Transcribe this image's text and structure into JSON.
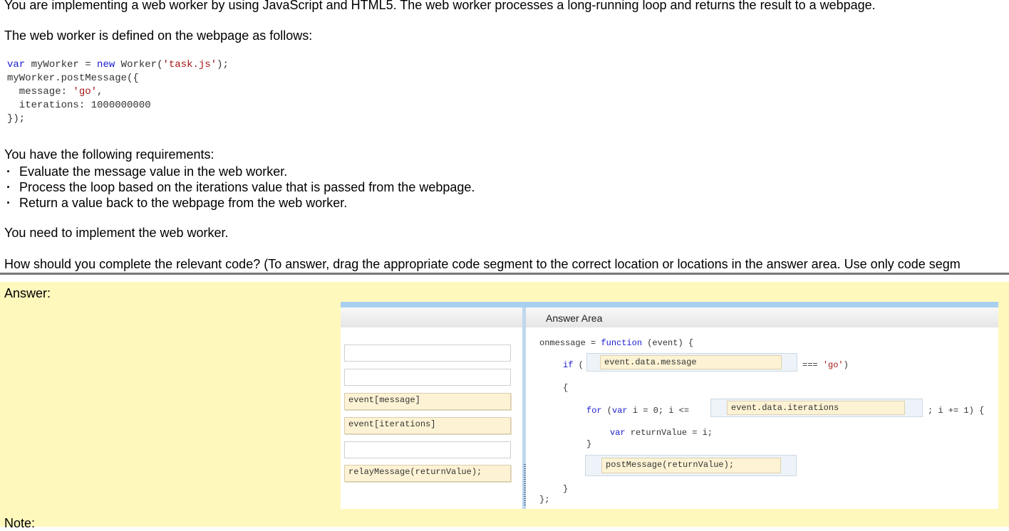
{
  "question": {
    "intro": "You are implementing a web worker by using JavaScript and HTML5. The web worker processes a long-running loop and returns the result to a webpage.",
    "defined_as": "The web worker is defined on the webpage as follows:",
    "code": {
      "line1_kw_var": "var",
      "line1_a": " myWorker = ",
      "line1_kw_new": "new",
      "line1_b": " Worker(",
      "line1_str": "'task.js'",
      "line1_c": ");",
      "line2": "myWorker.postMessage({",
      "line3_a": "  message: ",
      "line3_str": "'go'",
      "line3_b": ",",
      "line4": "  iterations: 1000000000",
      "line5": "});"
    },
    "requirements_heading": "You have the following requirements:",
    "requirements": [
      "Evaluate the message value in the web worker.",
      "Process the loop based on the iterations value that is passed from the webpage.",
      "Return a value back to the webpage from the web worker."
    ],
    "need": "You need to implement the web worker.",
    "instruction": "How should you complete the relevant code? (To answer, drag the appropriate code segment to the correct location or locations in the answer area. Use only code segm"
  },
  "answer": {
    "label": "Answer:",
    "note_label": "Note:",
    "area_title": "Answer Area",
    "source_segments": [
      "",
      "",
      "event[message]",
      "event[iterations]",
      "",
      "relayMessage(returnValue);"
    ],
    "code_lines": {
      "l1_a": "onmessage = ",
      "l1_kw": "function",
      "l1_b": " (event) {",
      "l2_kw": "if",
      "l2_a": " (",
      "l2_b": "=== ",
      "l2_str": "'go'",
      "l2_c": ")",
      "l3": "{",
      "l4_kw": "for",
      "l4_a": " (",
      "l4_kw2": "var",
      "l4_b": " i = 0; i <=",
      "l4_c": "; i += 1) {",
      "l5_kw": "var",
      "l5_a": " returnValue = i;",
      "l6": "}",
      "l7": "}",
      "l8": "};"
    },
    "placed": {
      "message_check": "event.data.message",
      "iterations_limit": "event.data.iterations",
      "return_call": "postMessage(returnValue);"
    }
  }
}
